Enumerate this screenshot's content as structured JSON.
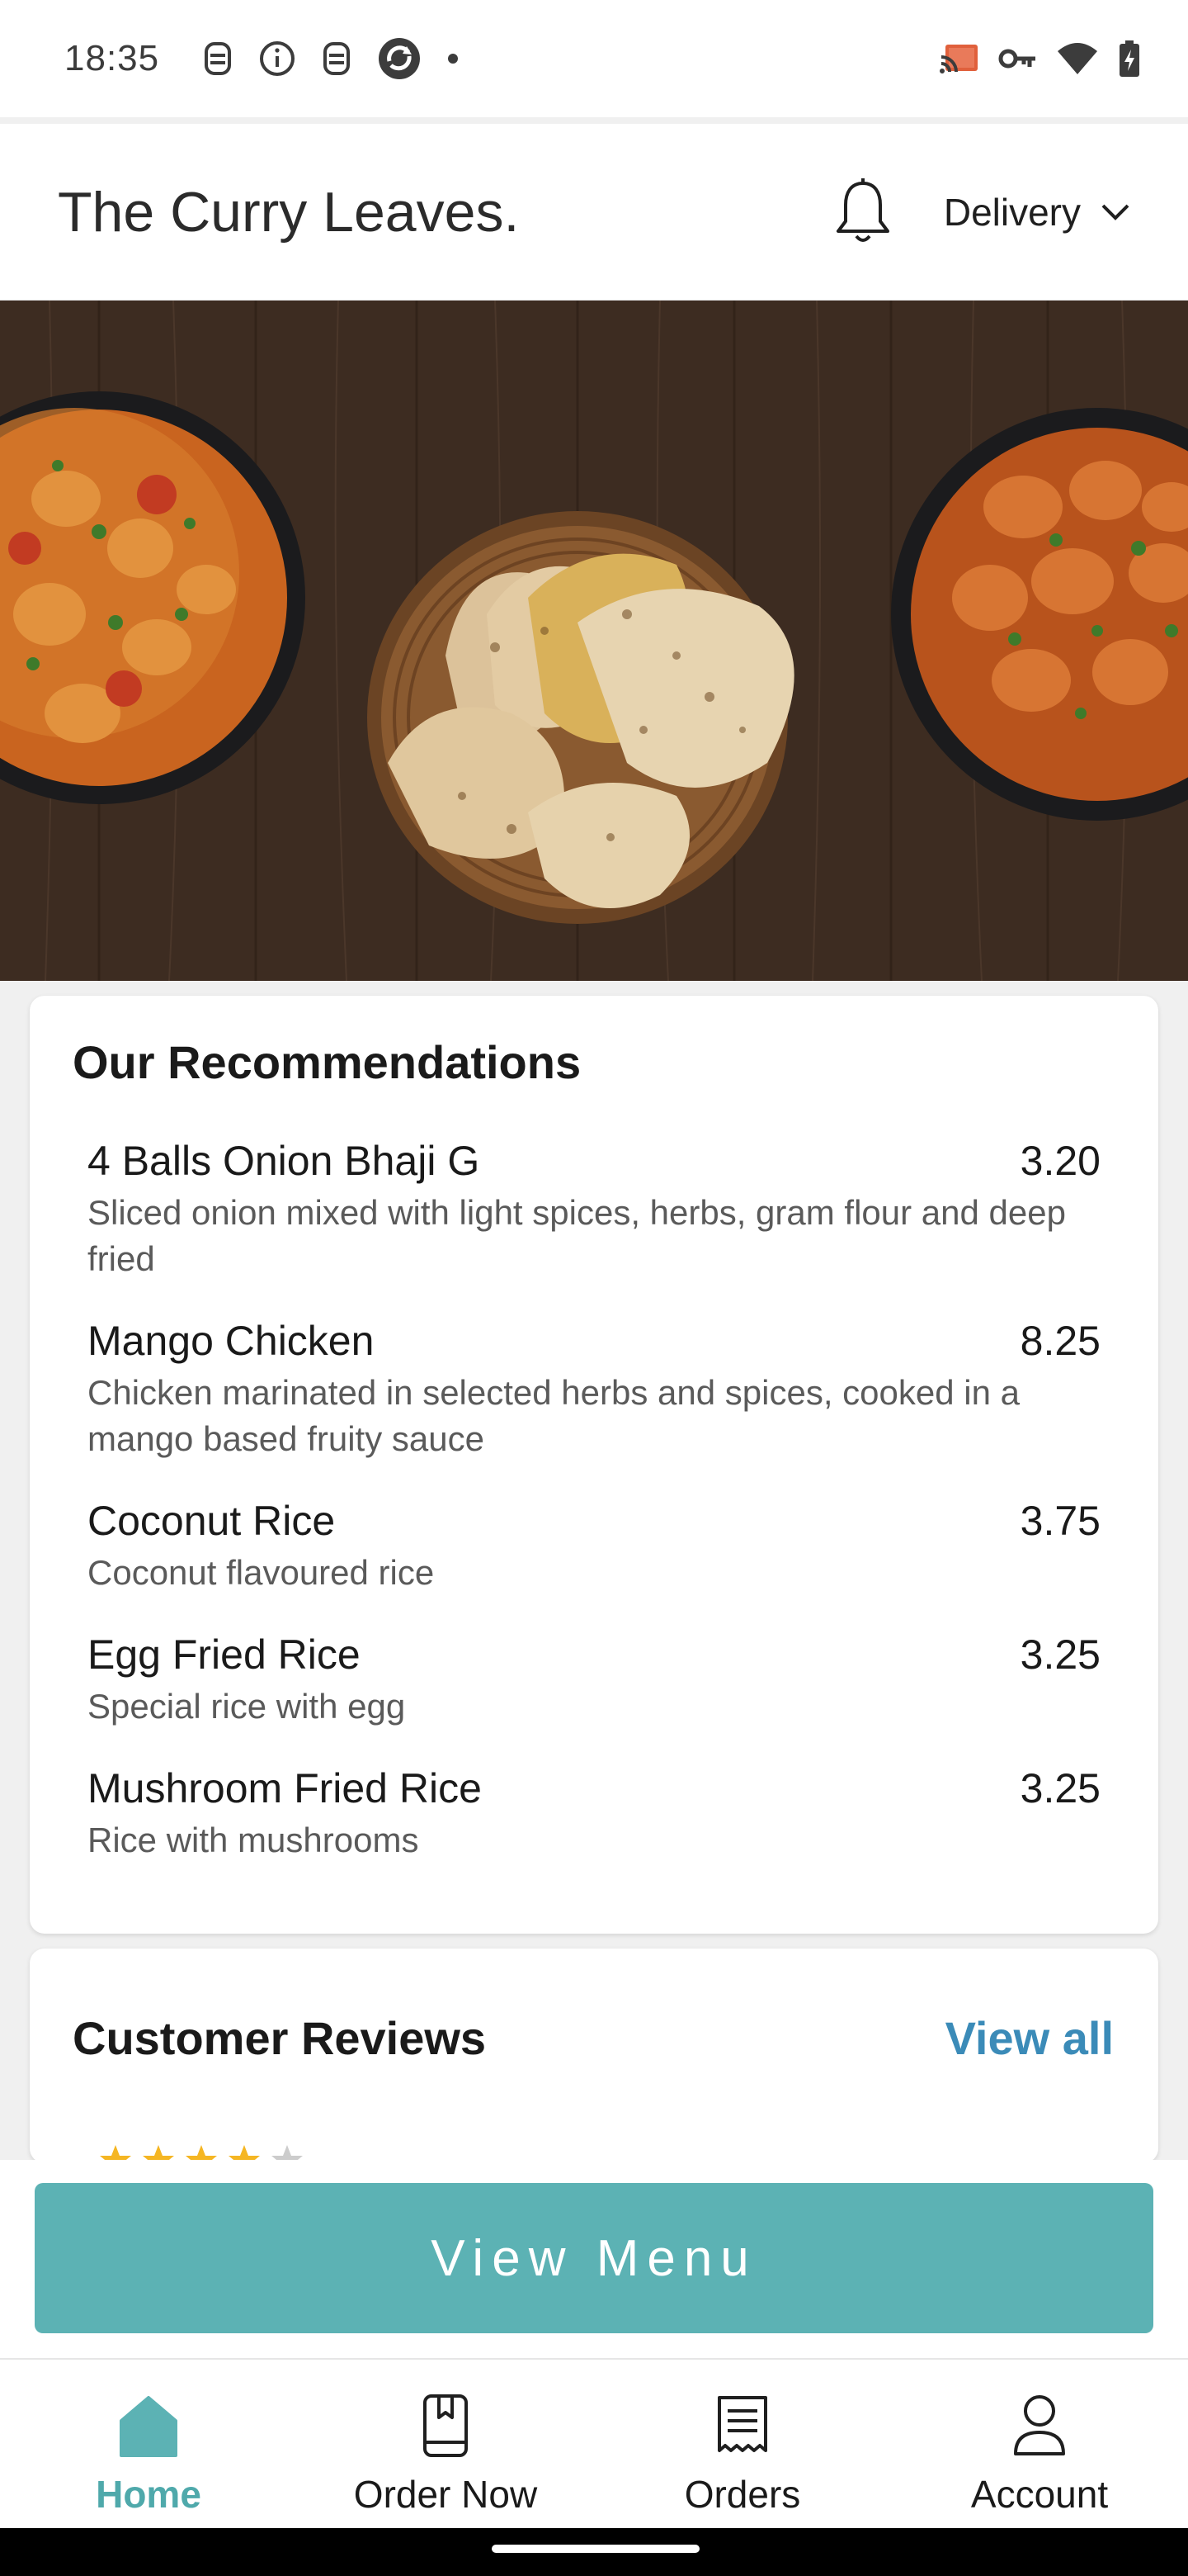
{
  "status_bar": {
    "time": "18:35",
    "left_icons": [
      "face-unlock-icon",
      "info-icon",
      "face-unlock-icon",
      "sync-app-icon",
      "dot-icon"
    ],
    "right_icons": [
      "cast-icon",
      "key-icon",
      "wifi-icon",
      "battery-icon"
    ]
  },
  "header": {
    "title": "The Curry Leaves.",
    "notification_icon": "bell-icon",
    "delivery_label": "Delivery",
    "dropdown_icon": "chevron-down-icon"
  },
  "hero": {
    "image": "food-banner"
  },
  "recommendations": {
    "title": "Our Recommendations",
    "items": [
      {
        "name": "4 Balls Onion Bhaji G",
        "price": "3.20",
        "description": "Sliced onion mixed with light spices, herbs, gram flour and deep fried"
      },
      {
        "name": "Mango Chicken",
        "price": "8.25",
        "description": "Chicken marinated in selected herbs and spices, cooked in a mango based fruity sauce"
      },
      {
        "name": "Coconut Rice",
        "price": "3.75",
        "description": "Coconut flavoured rice"
      },
      {
        "name": "Egg Fried Rice",
        "price": "3.25",
        "description": "Special rice with egg"
      },
      {
        "name": "Mushroom Fried Rice",
        "price": "3.25",
        "description": "Rice with mushrooms"
      }
    ]
  },
  "reviews": {
    "title": "Customer Reviews",
    "view_all_label": "View all"
  },
  "view_menu": {
    "label": "View Menu"
  },
  "bottom_nav": {
    "items": [
      {
        "label": "Home",
        "icon": "home-icon",
        "active": true
      },
      {
        "label": "Order Now",
        "icon": "order-book-icon",
        "active": false
      },
      {
        "label": "Orders",
        "icon": "receipt-icon",
        "active": false
      },
      {
        "label": "Account",
        "icon": "account-icon",
        "active": false
      }
    ]
  },
  "colors": {
    "accent": "#5cb2b4",
    "accent_text": "#4fa9ab",
    "link": "#3b8bb8",
    "star": "#f5b623"
  }
}
